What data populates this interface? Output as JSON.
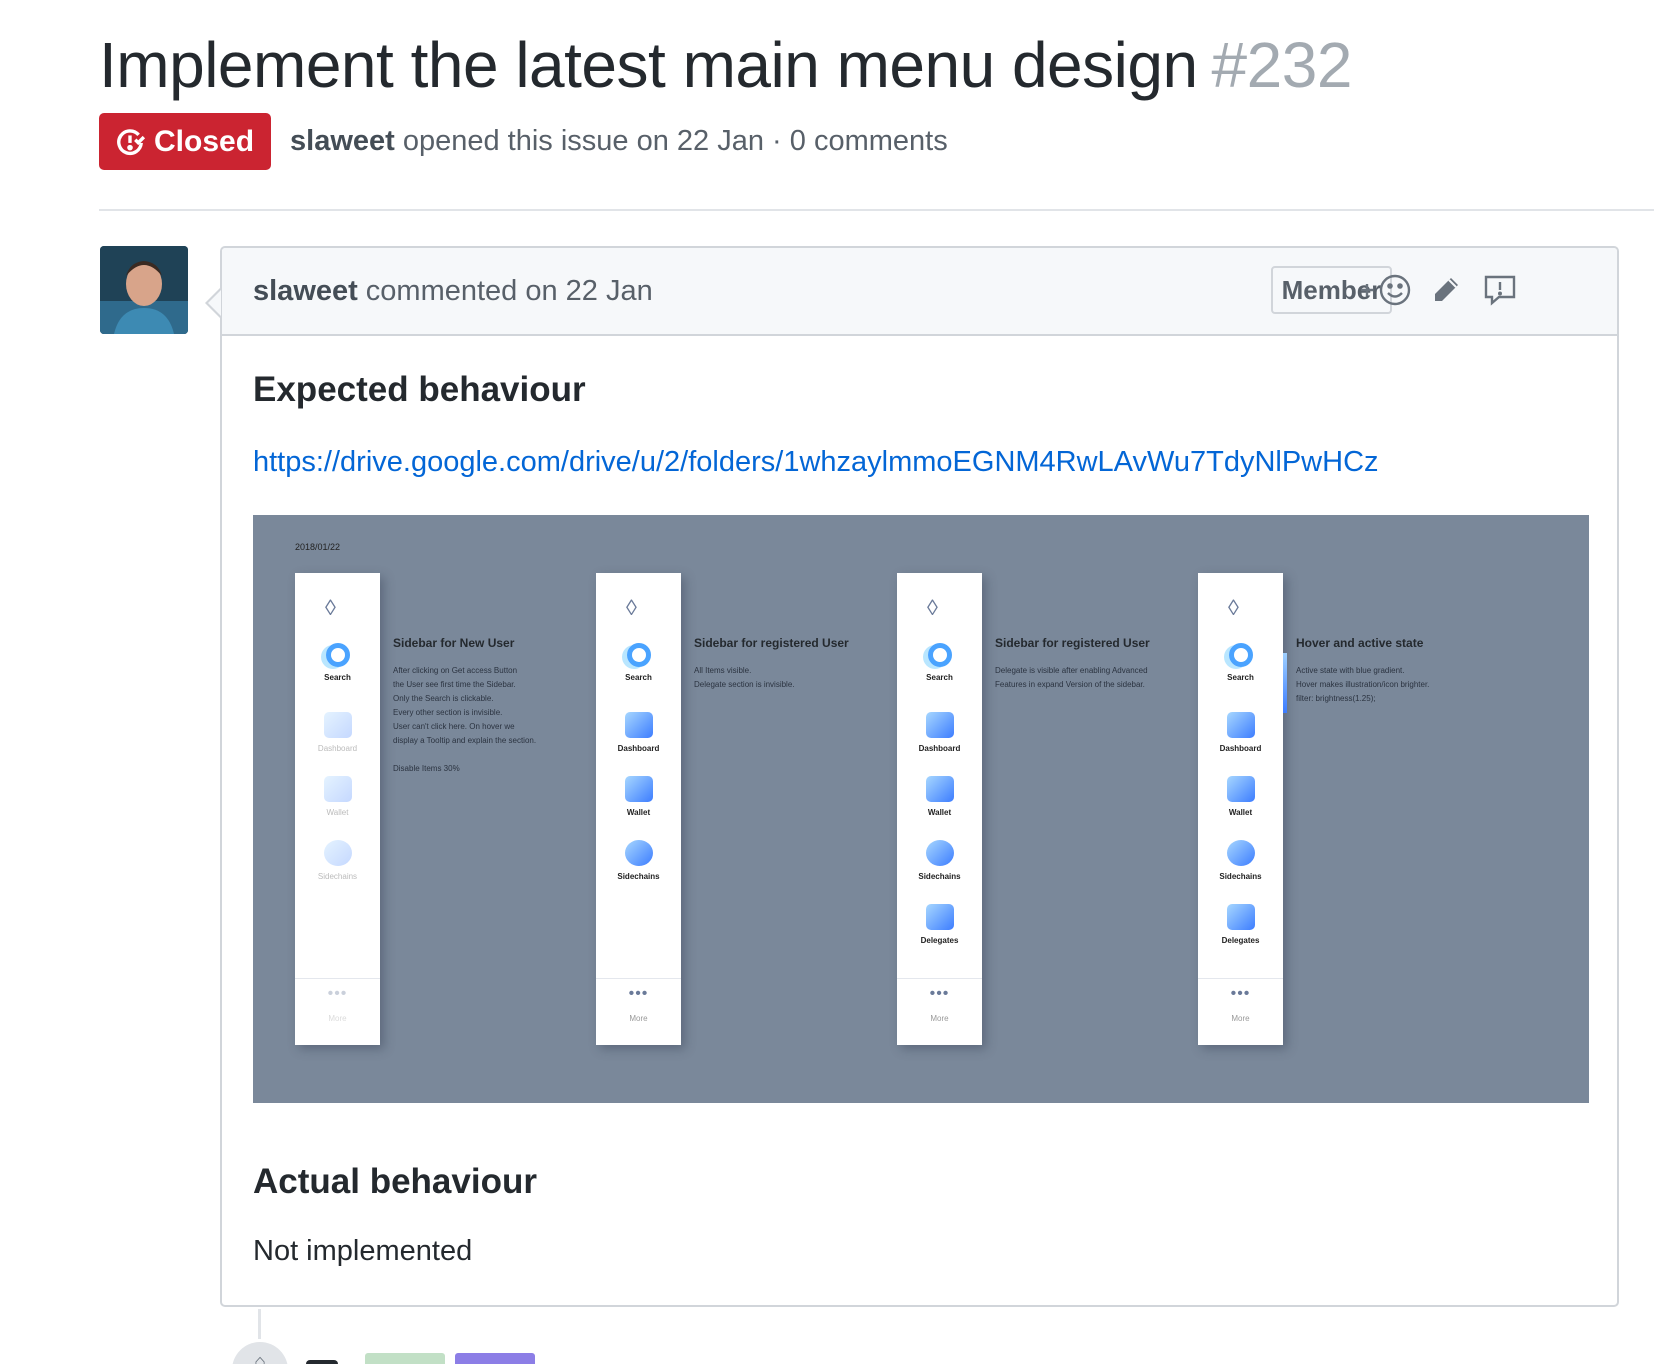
{
  "issue": {
    "title": "Implement the latest main menu design",
    "number": "#232",
    "state": "Closed",
    "state_color": "#cb2431",
    "author": "slaweet",
    "opened_text": "opened this issue on 22 Jan · 0 comments"
  },
  "comment": {
    "author": "slaweet",
    "meta": "commented on 22 Jan",
    "badge": "Member",
    "icons": [
      "add-reaction-icon",
      "pencil-icon",
      "report-icon"
    ],
    "heading_expected": "Expected behaviour",
    "link": "https://drive.google.com/drive/u/2/folders/1whzaylmmoEGNM4RwLAvWu7TdyNlPwHCz",
    "heading_actual": "Actual behaviour",
    "actual_text": "Not implemented"
  },
  "design": {
    "date": "2018/01/22",
    "labels": {
      "search": "Search",
      "dashboard": "Dashboard",
      "wallet": "Wallet",
      "sidechains": "Sidechains",
      "delegates": "Delegates",
      "more": "More",
      "dots": "•••"
    },
    "panels": [
      {
        "title": "Sidebar for New User",
        "lines": [
          "After clicking on Get access Button",
          "the User see first time the Sidebar.",
          "Only the Search is clickable.",
          "Every other section is invisible.",
          "User can't click here. On hover we",
          "display a Tooltip and explain the section.",
          "",
          "Disable Items 30%"
        ]
      },
      {
        "title": "Sidebar for registered User",
        "lines": [
          "All Items visible.",
          "Delegate section is invisible."
        ]
      },
      {
        "title": "Sidebar for registered User",
        "lines": [
          "Delegate is visible after enabling Advanced",
          "Features in expand Version of the sidebar."
        ]
      },
      {
        "title": "Hover and active state",
        "lines": [
          "Active state with blue gradient.",
          "Hover makes illustration/icon brighter.",
          "filter: brightness(1.25);"
        ]
      }
    ]
  },
  "colors": {
    "link": "#0366d6",
    "mockup_background": "#7a889a"
  }
}
